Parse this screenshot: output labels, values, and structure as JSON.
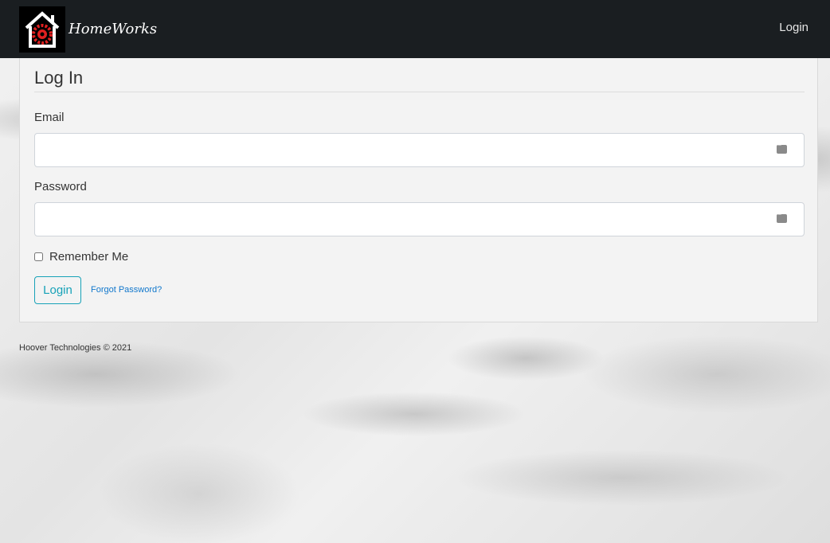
{
  "navbar": {
    "brand_name": "HomeWorks",
    "login_link": "Login",
    "colors": {
      "background": "#1a1e21",
      "logo_gear": "#e02020"
    }
  },
  "login_card": {
    "title": "Log In",
    "email_label": "Email",
    "email_value": "",
    "password_label": "Password",
    "password_value": "",
    "remember_label": "Remember Me",
    "remember_checked": false,
    "login_button": "Login",
    "forgot_link": "Forgot Password?",
    "colors": {
      "button_accent": "#17a2b8",
      "link": "#1177cc"
    }
  },
  "footer": {
    "text": "Hoover Technologies © 2021"
  }
}
